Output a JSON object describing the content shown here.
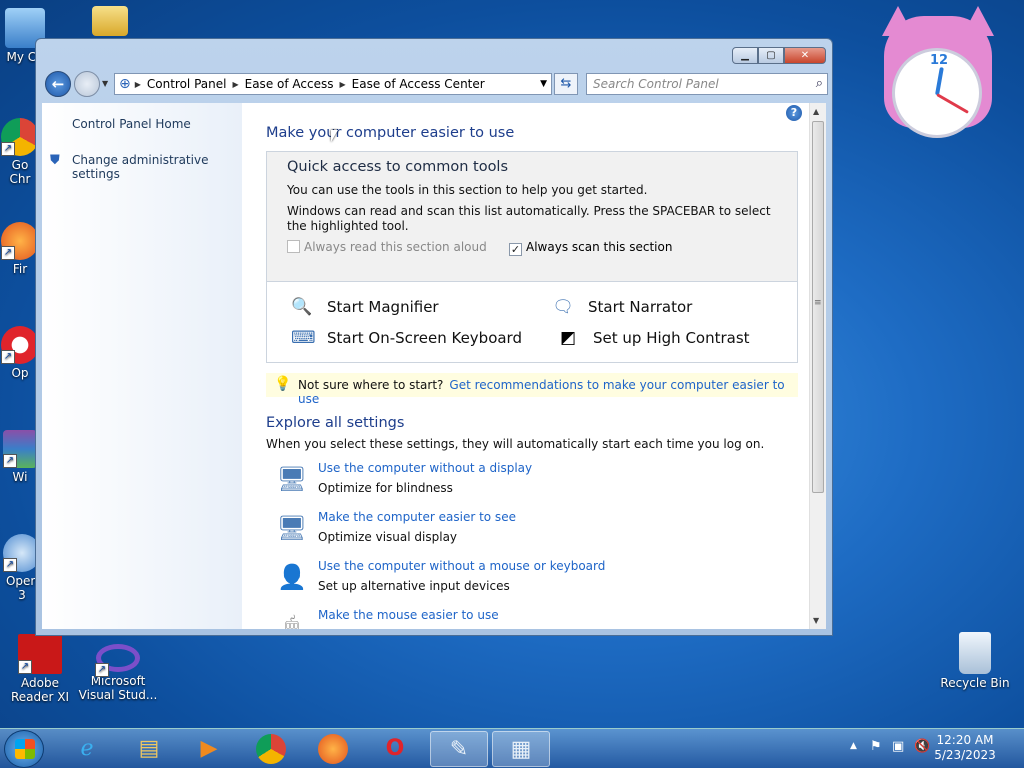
{
  "desktop": {
    "icons": [
      {
        "label": "My Co"
      },
      {
        "label": "Go\nChr"
      },
      {
        "label": "Fir"
      },
      {
        "label": "Op"
      },
      {
        "label": "Wi"
      },
      {
        "label": "Open\n3"
      },
      {
        "label": "Adobe Reader XI"
      },
      {
        "label": "Microsoft Visual Stud..."
      },
      {
        "label": "Recycle Bin"
      }
    ]
  },
  "clock": {
    "number": "12"
  },
  "window": {
    "address": {
      "segments": [
        "Control Panel",
        "Ease of Access",
        "Ease of Access Center"
      ]
    },
    "search": {
      "placeholder": "Search Control Panel"
    },
    "left_pane": {
      "home_link": "Control Panel Home",
      "admin_link": "Change administrative settings"
    },
    "main": {
      "title": "Make your computer easier to use",
      "quick": {
        "title": "Quick access to common tools",
        "line1": "You can use the tools in this section to help you get started.",
        "line2": "Windows can read and scan this list automatically.  Press the SPACEBAR to select the highlighted tool.",
        "read_aloud": {
          "label": "Always read this section aloud",
          "checked": false
        },
        "scan": {
          "label": "Always scan this section",
          "checked": true
        },
        "tools": [
          {
            "label": "Start Magnifier",
            "icon": "magnifier-icon"
          },
          {
            "label": "Start Narrator",
            "icon": "narrator-icon"
          },
          {
            "label": "Start On-Screen Keyboard",
            "icon": "keyboard-icon"
          },
          {
            "label": "Set up High Contrast",
            "icon": "contrast-icon"
          }
        ]
      },
      "tip": {
        "text": "Not sure where to start?",
        "link": "Get recommendations to make your computer easier to use"
      },
      "explore": {
        "title": "Explore all settings",
        "desc": "When you select these settings, they will automatically start each time you log on.",
        "items": [
          {
            "link": "Use the computer without a display",
            "sub": "Optimize for blindness"
          },
          {
            "link": "Make the computer easier to see",
            "sub": "Optimize visual display"
          },
          {
            "link": "Use the computer without a mouse or keyboard",
            "sub": "Set up alternative input devices"
          },
          {
            "link": "Make the mouse easier to use",
            "sub": ""
          }
        ]
      }
    }
  },
  "taskbar": {
    "time": "12:20 AM",
    "date": "5/23/2023"
  }
}
